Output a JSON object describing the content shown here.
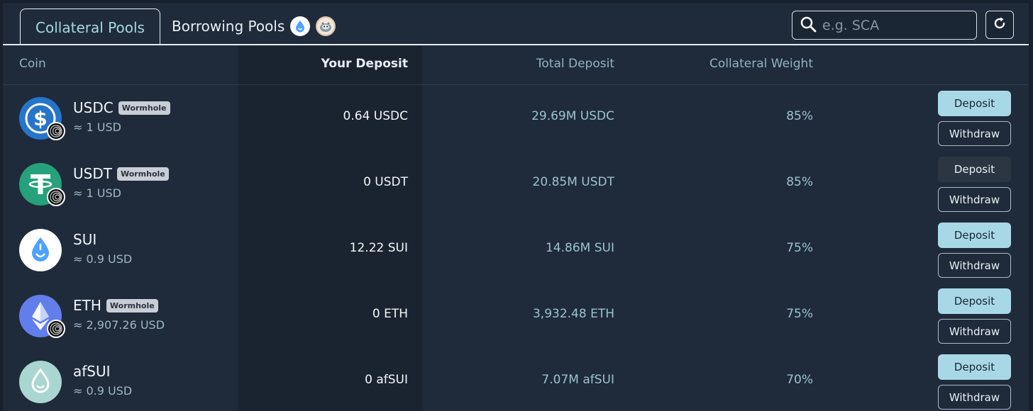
{
  "tabs": {
    "collateral_label": "Collateral Pools",
    "borrowing_label": "Borrowing Pools"
  },
  "search": {
    "placeholder": "e.g. SCA"
  },
  "table": {
    "headers": {
      "coin": "Coin",
      "your_deposit": "Your Deposit",
      "total_deposit": "Total Deposit",
      "collateral_weight": "Collateral Weight"
    },
    "rows": [
      {
        "name": "USDC",
        "tag": "Wormhole",
        "price": "≈ 1 USD",
        "your_deposit": "0.64 USDC",
        "total_deposit": "29.69M USDC",
        "weight": "85%",
        "deposit_label": "Deposit",
        "withdraw_label": "Withdraw"
      },
      {
        "name": "USDT",
        "tag": "Wormhole",
        "price": "≈ 1 USD",
        "your_deposit": "0 USDT",
        "total_deposit": "20.85M USDT",
        "weight": "85%",
        "deposit_label": "Deposit",
        "withdraw_label": "Withdraw"
      },
      {
        "name": "SUI",
        "tag": "",
        "price": "≈ 0.9 USD",
        "your_deposit": "12.22 SUI",
        "total_deposit": "14.86M SUI",
        "weight": "75%",
        "deposit_label": "Deposit",
        "withdraw_label": "Withdraw"
      },
      {
        "name": "ETH",
        "tag": "Wormhole",
        "price": "≈ 2,907.26 USD",
        "your_deposit": "0 ETH",
        "total_deposit": "3,932.48 ETH",
        "weight": "75%",
        "deposit_label": "Deposit",
        "withdraw_label": "Withdraw"
      },
      {
        "name": "afSUI",
        "tag": "",
        "price": "≈ 0.9 USD",
        "your_deposit": "0 afSUI",
        "total_deposit": "7.07M afSUI",
        "weight": "70%",
        "deposit_label": "Deposit",
        "withdraw_label": "Withdraw"
      }
    ]
  },
  "colors": {
    "background": "#1f2b3b",
    "accent": "#a8d8e6",
    "active_tab_text": "#a5d8e3",
    "usdc": "#2775ca",
    "usdt": "#26a17b",
    "eth": "#627eea",
    "afsui": "#a9d6d0"
  }
}
